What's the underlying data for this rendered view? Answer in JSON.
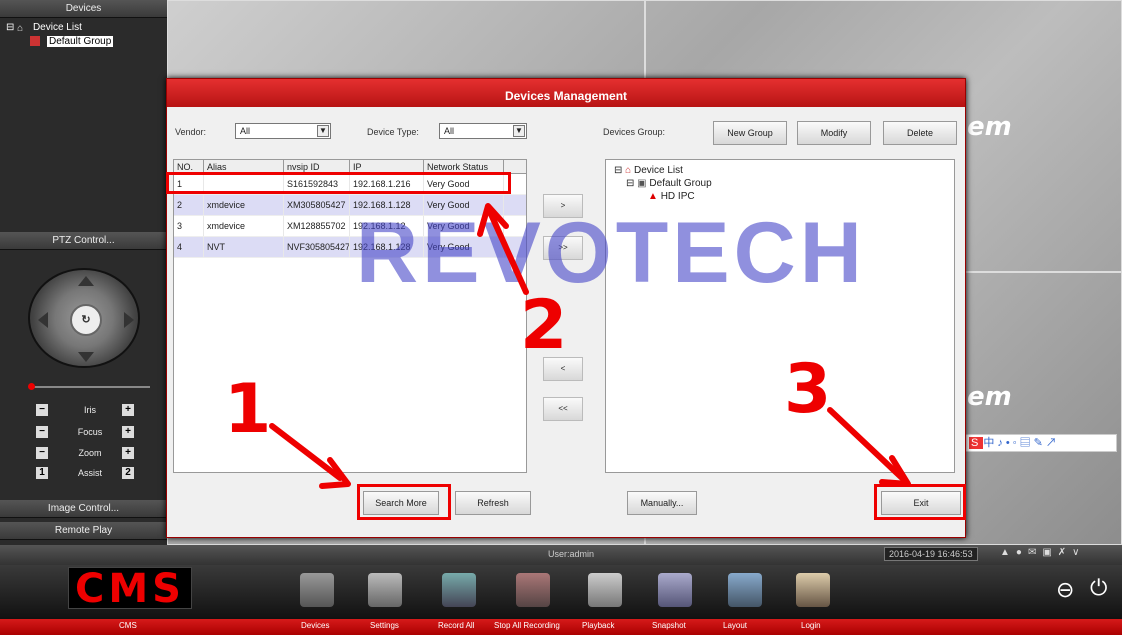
{
  "left_panel": {
    "devices_header": "Devices",
    "tree_root": "Device List",
    "tree_group": "Default Group",
    "ptz_control": "PTZ Control...",
    "controls": [
      {
        "minus": "−",
        "label": "Iris",
        "plus": "+"
      },
      {
        "minus": "−",
        "label": "Focus",
        "plus": "+"
      },
      {
        "minus": "−",
        "label": "Zoom",
        "plus": "+"
      },
      {
        "minus": "1",
        "label": "Assist",
        "plus": "2"
      }
    ],
    "image_control": "Image Control...",
    "remote_play": "Remote Play"
  },
  "background": {
    "tem_text": "em"
  },
  "dialog": {
    "title": "Devices Management",
    "vendor_label": "Vendor:",
    "vendor_value": "All",
    "device_type_label": "Device Type:",
    "device_type_value": "All",
    "devices_group_label": "Devices Group:",
    "new_group": "New Group",
    "modify": "Modify",
    "delete": "Delete",
    "columns": [
      "NO.",
      "Alias",
      "nvsip ID",
      "IP",
      "Network Status"
    ],
    "rows": [
      {
        "no": "1",
        "alias": "",
        "id": "S161592843",
        "ip": "192.168.1.216",
        "status": "Very Good"
      },
      {
        "no": "2",
        "alias": "xmdevice",
        "id": "XM305805427",
        "ip": "192.168.1.128",
        "status": "Very Good"
      },
      {
        "no": "3",
        "alias": "xmdevice",
        "id": "XM128855702",
        "ip": "192.168.1.12",
        "status": "Very Good"
      },
      {
        "no": "4",
        "alias": "NVT",
        "id": "NVF305805427",
        "ip": "192.168.1.128",
        "status": "Very Good"
      }
    ],
    "add_one": ">",
    "add_all": ">>",
    "remove_one": "<",
    "remove_all": "<<",
    "group_tree": {
      "root": "Device List",
      "group": "Default Group",
      "device": "HD IPC"
    },
    "search_more": "Search More",
    "refresh": "Refresh",
    "manually": "Manually...",
    "exit": "Exit"
  },
  "annotations": {
    "n1": "1",
    "n2": "2",
    "n3": "3",
    "watermark": "REVOTECH"
  },
  "status_bar": {
    "user": "User:admin",
    "datetime": "2016-04-19 16:46:53"
  },
  "toolbar": {
    "logo": "CMS",
    "items": [
      "CMS",
      "Devices",
      "Settings",
      "Record All",
      "Stop All Recording",
      "Playback",
      "Snapshot",
      "Layout",
      "Login"
    ]
  },
  "colors": {
    "accent": "#c21a1a",
    "highlight": "#e00000",
    "watermark": "#4646c8"
  }
}
